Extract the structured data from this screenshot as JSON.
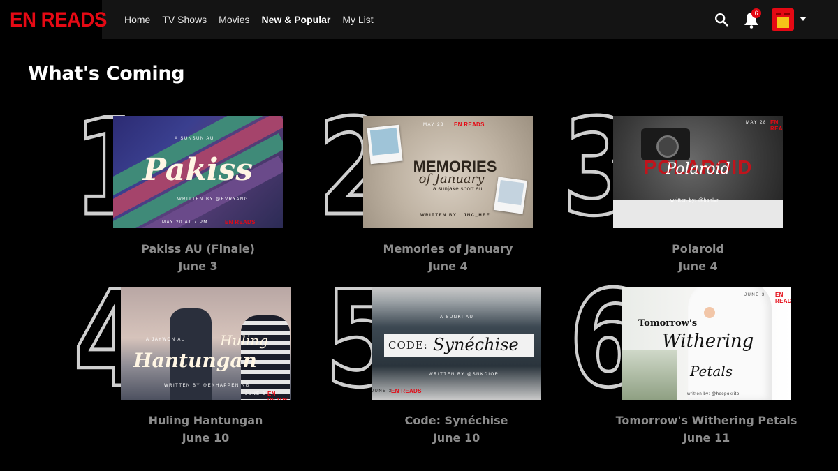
{
  "nav": {
    "logo": "EN READS",
    "links": [
      {
        "label": "Home",
        "active": false
      },
      {
        "label": "TV Shows",
        "active": false
      },
      {
        "label": "Movies",
        "active": false
      },
      {
        "label": "New & Popular",
        "active": true
      },
      {
        "label": "My List",
        "active": false
      }
    ],
    "notification_count": "6",
    "icons": [
      "search-icon",
      "bell-icon",
      "avatar",
      "caret-down-icon"
    ],
    "brand_color": "#e50914"
  },
  "section": {
    "title": "What's Coming"
  },
  "items": [
    {
      "rank": "1",
      "title": "Pakiss AU (Finale)",
      "date": "June 3",
      "poster": {
        "kicker": "A SUNSUN AU",
        "title": "Pakiss",
        "credit": "WRITTEN BY @EVRYANG",
        "footer": "MAY 20 AT 7 PM",
        "badge": "EN READS"
      }
    },
    {
      "rank": "2",
      "title": "Memories of January",
      "date": "June 4",
      "poster": {
        "kicker": "MAY 28",
        "title": "MEMORIES",
        "title2": "of January",
        "subtitle": "a sunjake short au",
        "credit": "WRITTEN BY : JNC_HEE",
        "badge": "EN READS"
      }
    },
    {
      "rank": "3",
      "title": "Polaroid",
      "date": "June 4",
      "poster": {
        "kicker": "MAY 28",
        "title": "POLAROID",
        "title2": "Polaroid",
        "credit": "written by: @hshlvr",
        "badge": "EN READS"
      }
    },
    {
      "rank": "4",
      "title": "Huling Hantungan",
      "date": "June 10",
      "poster": {
        "kicker": "A JAYWON AU",
        "title": "Huling",
        "title2": "Hantungan",
        "credit": "WRITTEN BY @ENHAPPENING",
        "footer": "JUNE 3",
        "badge": "EN READS"
      }
    },
    {
      "rank": "5",
      "title": "Code: Synéchise",
      "date": "June 10",
      "poster": {
        "kicker": "A SUNKI AU",
        "title": "CODE:",
        "title2": "Synéchise",
        "credit": "WRITTEN BY @SNKDIOR",
        "footer": "JUNE 3",
        "badge": "EN READS"
      }
    },
    {
      "rank": "6",
      "title": "Tomorrow's Withering Petals",
      "date": "June 11",
      "poster": {
        "kicker": "JUNE 3",
        "title": "Tomorrow's",
        "title2": "Withering",
        "title3": "Petals",
        "credit": "written by: @heepokrito",
        "badge": "EN READS"
      }
    }
  ]
}
